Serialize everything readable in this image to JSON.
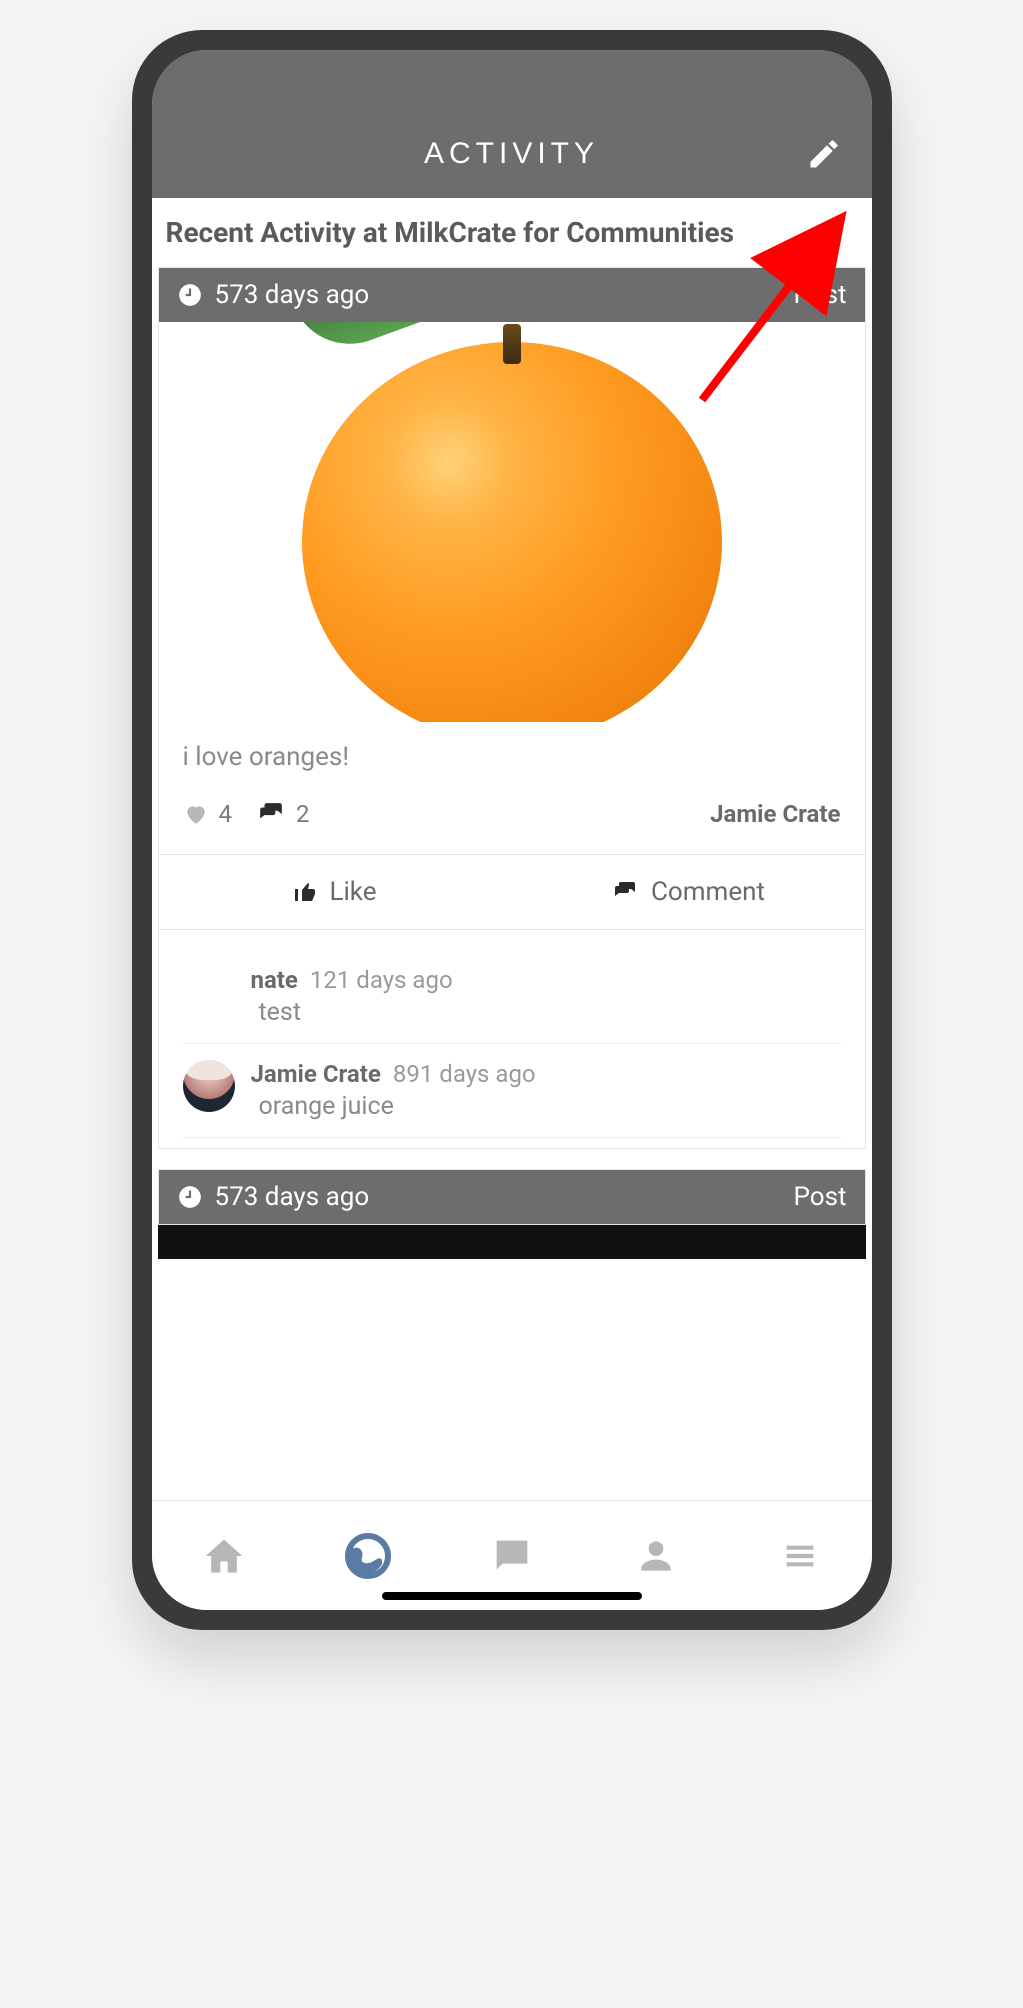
{
  "header": {
    "title": "ACTIVITY"
  },
  "section_title": "Recent Activity at MilkCrate for Communities",
  "posts": [
    {
      "timestamp": "573 days ago",
      "type_label": "Post",
      "image_desc": "orange-fruit",
      "text": "i love oranges!",
      "like_count": "4",
      "comment_count": "2",
      "author": "Jamie Crate",
      "actions": {
        "like": "Like",
        "comment": "Comment"
      },
      "comments": [
        {
          "author": "nate",
          "time": "121 days ago",
          "text": "test",
          "avatar": "blank"
        },
        {
          "author": "Jamie Crate",
          "time": "891 days ago",
          "text": "orange juice",
          "avatar": "person"
        }
      ]
    },
    {
      "timestamp": "573 days ago",
      "type_label": "Post"
    }
  ],
  "nav": {
    "home": "home",
    "globe": "globe",
    "chat": "chat",
    "profile": "profile",
    "menu": "menu",
    "active": "globe"
  },
  "colors": {
    "header_bg": "#6d6d6d",
    "text_muted": "#8a8a8a",
    "nav_active": "#5a7ba3"
  }
}
